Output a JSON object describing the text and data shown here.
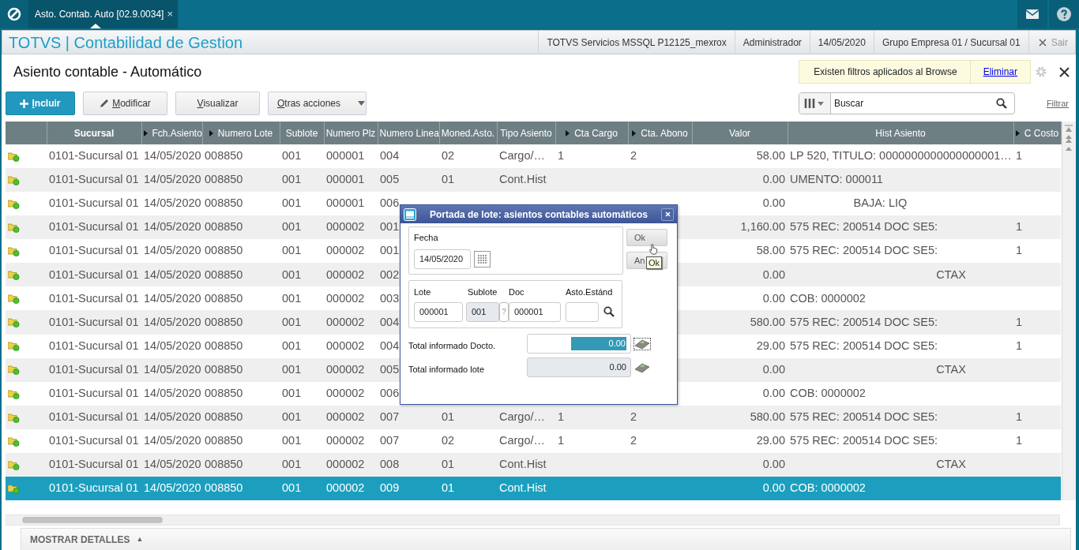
{
  "app_bar": {
    "tab": {
      "label": "Asto. Contab. Auto [02.9.0034]",
      "close": "×",
      "selected": true
    }
  },
  "header": {
    "title": "TOTVS | Contabilidad de Gestion",
    "info": [
      "TOTVS Servicios MSSQL P12125_mexrox",
      "Administrador",
      "14/05/2020",
      "Grupo Empresa 01 / Sucursal 01"
    ],
    "exit": "Sair"
  },
  "page_title": "Asiento contable - Automático",
  "filter_notice": {
    "text": "Existen filtros aplicados al Browse",
    "link": "Eliminar"
  },
  "toolbar": {
    "buttons": [
      {
        "label": "Incluir",
        "kind": "primary"
      },
      {
        "label": "Modificar",
        "kind": "edit"
      },
      {
        "label": "Visualizar",
        "kind": "plain"
      },
      {
        "label": "Otras acciones",
        "kind": "dropdown"
      }
    ],
    "search": {
      "placeholder": "Buscar"
    },
    "filter_link": "Filtrar"
  },
  "table": {
    "columns": [
      {
        "label": "Sucursal",
        "marker": false
      },
      {
        "label": "Fch.Asiento",
        "marker": true
      },
      {
        "label": "Numero Lote",
        "marker": true
      },
      {
        "label": "Sublote",
        "marker": false
      },
      {
        "label": "Numero Plz",
        "marker": false
      },
      {
        "label": "Numero Linea",
        "marker": false
      },
      {
        "label": "Moned.Asto.",
        "marker": false
      },
      {
        "label": "Tipo Asiento",
        "marker": false
      },
      {
        "label": "Cta Cargo",
        "marker": true
      },
      {
        "label": "Cta. Abono",
        "marker": true
      },
      {
        "label": "Valor",
        "marker": false
      },
      {
        "label": "Hist Asiento",
        "marker": false
      },
      {
        "label": "C Costo",
        "marker": true
      }
    ],
    "rows": [
      {
        "selected": false,
        "cells": [
          "0101-Sucursal 01",
          "14/05/2020",
          "008850",
          "001",
          "000001",
          "004",
          "02",
          "Cargo/…",
          "1",
          "2",
          "58.00",
          "LP 520, TITULO: 0000000000000000001…",
          "1"
        ]
      },
      {
        "selected": false,
        "cells": [
          "0101-Sucursal 01",
          "14/05/2020",
          "008850",
          "001",
          "000001",
          "005",
          "01",
          "Cont.Hist",
          null,
          null,
          "0.00",
          "UMENTO: 000011",
          null
        ]
      },
      {
        "selected": false,
        "cells": [
          "0101-Sucursal 01",
          "14/05/2020",
          "008850",
          "001",
          "000001",
          "006",
          null,
          null,
          null,
          null,
          "0.00",
          "                    BAJA: LIQ",
          null
        ]
      },
      {
        "selected": false,
        "cells": [
          "0101-Sucursal 01",
          "14/05/2020",
          "008850",
          "001",
          "000002",
          "001",
          null,
          null,
          null,
          null,
          "1,160.00",
          "575 REC: 200514 DOC SE5:",
          "1"
        ]
      },
      {
        "selected": false,
        "cells": [
          "0101-Sucursal 01",
          "14/05/2020",
          "008850",
          "001",
          "000002",
          "001",
          null,
          null,
          null,
          null,
          "58.00",
          "575 REC: 200514 DOC SE5:",
          "1"
        ]
      },
      {
        "selected": false,
        "cells": [
          "0101-Sucursal 01",
          "14/05/2020",
          "008850",
          "001",
          "000002",
          "002",
          null,
          null,
          null,
          null,
          "0.00",
          "                                              CTAX",
          null
        ]
      },
      {
        "selected": false,
        "cells": [
          "0101-Sucursal 01",
          "14/05/2020",
          "008850",
          "001",
          "000002",
          "003",
          null,
          null,
          null,
          null,
          "0.00",
          "COB: 0000002",
          null
        ]
      },
      {
        "selected": false,
        "cells": [
          "0101-Sucursal 01",
          "14/05/2020",
          "008850",
          "001",
          "000002",
          "004",
          null,
          null,
          null,
          null,
          "580.00",
          "575 REC: 200514 DOC SE5:",
          "1"
        ]
      },
      {
        "selected": false,
        "cells": [
          "0101-Sucursal 01",
          "14/05/2020",
          "008850",
          "001",
          "000002",
          "004",
          null,
          null,
          null,
          null,
          "29.00",
          "575 REC: 200514 DOC SE5:",
          "1"
        ]
      },
      {
        "selected": false,
        "cells": [
          "0101-Sucursal 01",
          "14/05/2020",
          "008850",
          "001",
          "000002",
          "005",
          null,
          null,
          null,
          null,
          "0.00",
          "                                              CTAX",
          null
        ]
      },
      {
        "selected": false,
        "cells": [
          "0101-Sucursal 01",
          "14/05/2020",
          "008850",
          "001",
          "000002",
          "006",
          null,
          null,
          null,
          null,
          "0.00",
          "COB: 0000002",
          null
        ]
      },
      {
        "selected": false,
        "cells": [
          "0101-Sucursal 01",
          "14/05/2020",
          "008850",
          "001",
          "000002",
          "007",
          "01",
          "Cargo/…",
          "1",
          "2",
          "580.00",
          "575 REC: 200514 DOC SE5:",
          "1"
        ]
      },
      {
        "selected": false,
        "cells": [
          "0101-Sucursal 01",
          "14/05/2020",
          "008850",
          "001",
          "000002",
          "007",
          "02",
          "Cargo/…",
          "1",
          "2",
          "29.00",
          "575 REC: 200514 DOC SE5:",
          "1"
        ]
      },
      {
        "selected": false,
        "cells": [
          "0101-Sucursal 01",
          "14/05/2020",
          "008850",
          "001",
          "000002",
          "008",
          "01",
          "Cont.Hist",
          null,
          null,
          "0.00",
          "                                              CTAX",
          null
        ]
      },
      {
        "selected": true,
        "cells": [
          "0101-Sucursal 01",
          "14/05/2020",
          "008850",
          "001",
          "000002",
          "009",
          "01",
          "Cont.Hist",
          null,
          null,
          "0.00",
          "COB: 0000002",
          null
        ]
      }
    ]
  },
  "details_toggle": {
    "label": "MOSTRAR DETALLES",
    "arrow": "▲"
  },
  "dialog": {
    "title": "Portada de lote: asientos contables automáticos",
    "date": {
      "label": "Fecha",
      "value": "14/05/2020"
    },
    "fields": [
      {
        "label": "Lote",
        "value": "000001",
        "disabled": false
      },
      {
        "label": "Sublote",
        "value": "001",
        "disabled": true,
        "help": "?"
      },
      {
        "label": "Doc",
        "value": "000001",
        "disabled": false
      },
      {
        "label": "Asto.Estánd",
        "disabled": false,
        "lookup": true
      }
    ],
    "buttons": [
      {
        "label": "Ok"
      },
      {
        "label": "An"
      }
    ],
    "tooltip": "Ok",
    "totals": [
      {
        "label": "Total informado Docto.",
        "value": "0.00",
        "highlighted": true,
        "disabled": false
      },
      {
        "label": "Total informado lote",
        "value": "0.00",
        "highlighted": false,
        "disabled": true
      }
    ]
  }
}
